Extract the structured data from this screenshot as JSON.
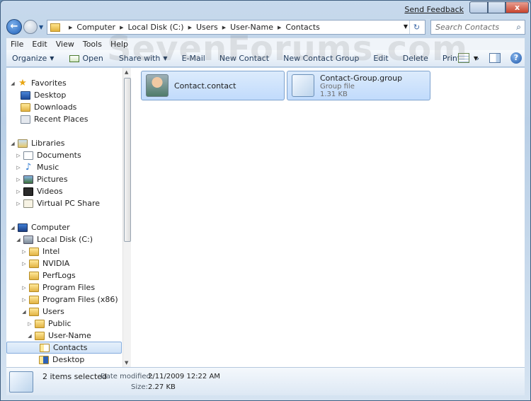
{
  "titlebar": {
    "feedback": "Send Feedback",
    "min": "–",
    "max": "□",
    "close": "x"
  },
  "address": {
    "crumbs": [
      "Computer",
      "Local Disk (C:)",
      "Users",
      "User-Name",
      "Contacts"
    ],
    "refresh": "↻"
  },
  "search": {
    "placeholder": "Search Contacts"
  },
  "menu": [
    "File",
    "Edit",
    "View",
    "Tools",
    "Help"
  ],
  "toolbar": {
    "organize": "Organize",
    "open": "Open",
    "share": "Share with",
    "email": "E-Mail",
    "new_contact": "New Contact",
    "new_group": "New Contact Group",
    "edit": "Edit",
    "delete": "Delete",
    "print": "Print",
    "more": "»",
    "help": "?"
  },
  "nav": {
    "favorites": "Favorites",
    "desktop": "Desktop",
    "downloads": "Downloads",
    "recent": "Recent Places",
    "libraries": "Libraries",
    "documents": "Documents",
    "music": "Music",
    "pictures": "Pictures",
    "videos": "Videos",
    "vpc": "Virtual PC Share",
    "computer": "Computer",
    "localdisk": "Local Disk (C:)",
    "intel": "Intel",
    "nvidia": "NVIDIA",
    "perflogs": "PerfLogs",
    "progfiles": "Program Files",
    "progfiles86": "Program Files (x86)",
    "users": "Users",
    "public": "Public",
    "username": "User-Name",
    "contacts": "Contacts",
    "udesktop": "Desktop"
  },
  "files": [
    {
      "name": "Contact.contact"
    },
    {
      "name": "Contact-Group.group",
      "type": "Group file",
      "size": "1.31 KB"
    }
  ],
  "status": {
    "count": "2 items selected",
    "date_label": "Date modified:",
    "date_value": "2/11/2009 12:22 AM",
    "size_label": "Size:",
    "size_value": "2.27 KB"
  },
  "watermark": "SevenForums.com"
}
